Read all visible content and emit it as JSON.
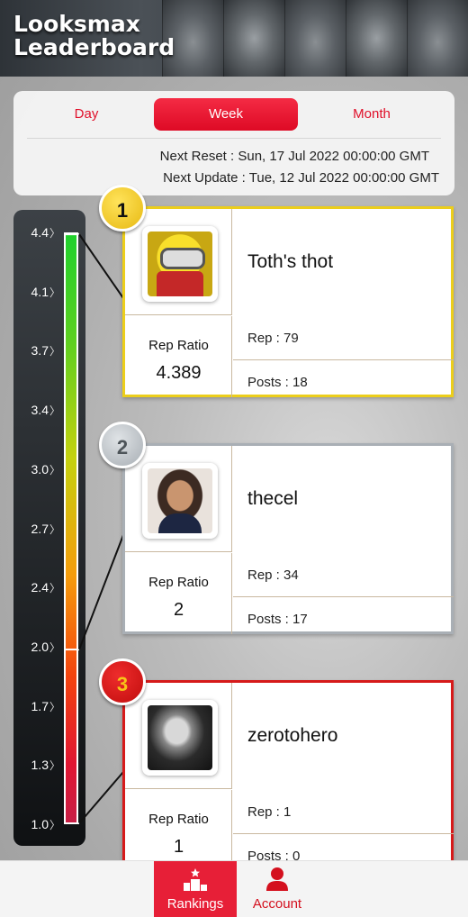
{
  "header": {
    "title_line1": "Looksmax",
    "title_line2": "Leaderboard"
  },
  "period_tabs": [
    {
      "label": "Day",
      "selected": false
    },
    {
      "label": "Week",
      "selected": true
    },
    {
      "label": "Month",
      "selected": false
    }
  ],
  "schedule": {
    "next_reset": "Next Reset : Sun, 17 Jul 2022 00:00:00 GMT",
    "next_update": "Next Update : Tue, 12 Jul 2022 00:00:00 GMT"
  },
  "scale": {
    "ticks": [
      "4.4",
      "4.1",
      "3.7",
      "3.4",
      "3.0",
      "2.7",
      "2.4",
      "2.0",
      "1.7",
      "1.3",
      "1.0"
    ],
    "min": 1.0,
    "max": 4.4
  },
  "leaderboard": [
    {
      "rank": "1",
      "name": "Toth's thot",
      "ratio_label": "Rep Ratio",
      "ratio": "4.389",
      "ratio_value": 4.389,
      "rep": "Rep : 79",
      "posts": "Posts : 18",
      "avatar_icon": "minion-avatar",
      "color": "#ecce1b"
    },
    {
      "rank": "2",
      "name": "thecel",
      "ratio_label": "Rep Ratio",
      "ratio": "2",
      "ratio_value": 2,
      "rep": "Rep : 34",
      "posts": "Posts : 17",
      "avatar_icon": "man-avatar",
      "color": "#a9afb5"
    },
    {
      "rank": "3",
      "name": "zerotohero",
      "ratio_label": "Rep Ratio",
      "ratio": "1",
      "ratio_value": 1,
      "rep": "Rep : 1",
      "posts": "Posts : 0",
      "avatar_icon": "bw-portrait-avatar",
      "color": "#d61a1a"
    }
  ],
  "nav": {
    "rankings_label": "Rankings",
    "account_label": "Account",
    "active": "Rankings",
    "accent": "#e71f37"
  }
}
